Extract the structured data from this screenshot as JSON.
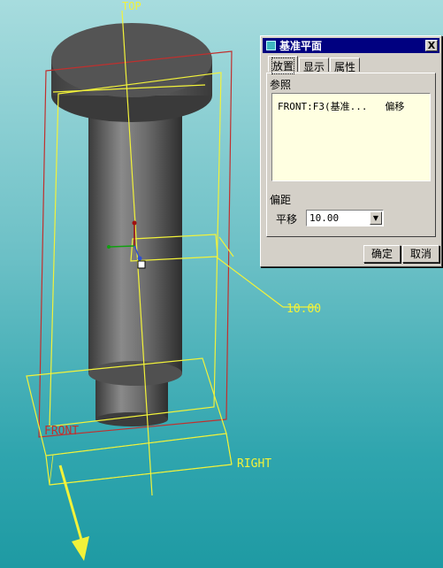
{
  "viewport": {
    "label_top": "TOP",
    "label_front": "FRONT",
    "label_right": "RIGHT",
    "offset_dimension": "10.00"
  },
  "dialog": {
    "title": "基准平面",
    "close_label": "X",
    "tabs": [
      "放置",
      "显示",
      "属性"
    ],
    "active_tab": 0,
    "references_label": "参照",
    "reference_item": "FRONT:F3(基准...   偏移",
    "offset_label": "偏距",
    "translation_label": "平移",
    "translation_value": "10.00",
    "ok_label": "确定",
    "cancel_label": "取消"
  },
  "colors": {
    "datum_yellow": "#f2f23a",
    "front_plane_red": "#c0302e",
    "title_bar": "#000080"
  }
}
